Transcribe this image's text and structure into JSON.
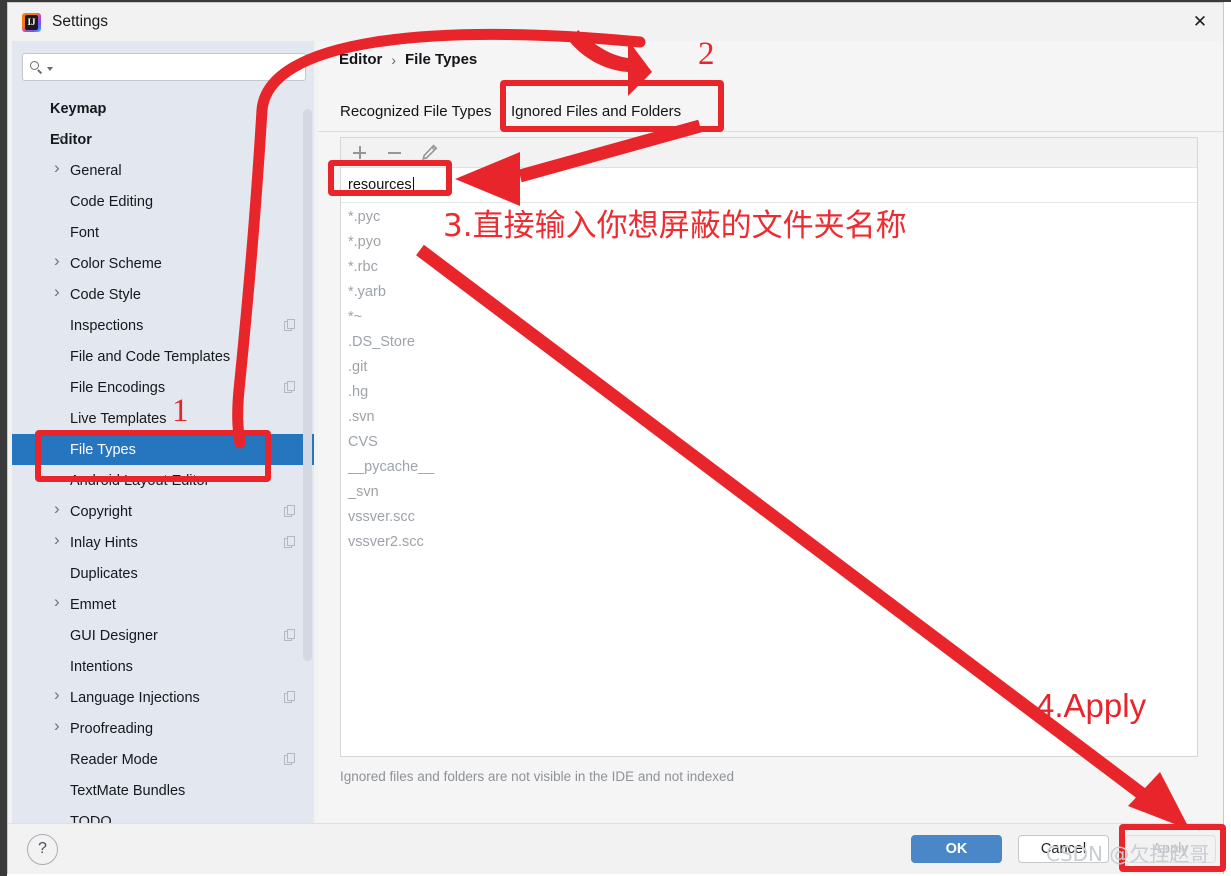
{
  "window": {
    "title": "Settings",
    "app_icon": "intellij-icon",
    "close_icon": "✕"
  },
  "sidebar": {
    "search": {
      "value": "",
      "placeholder": ""
    },
    "items": [
      {
        "label": "Keymap",
        "depth": 0,
        "arrow": "none",
        "badge": false,
        "selected": false
      },
      {
        "label": "Editor",
        "depth": 0,
        "arrow": "down",
        "badge": false,
        "selected": false
      },
      {
        "label": "General",
        "depth": 1,
        "arrow": "right",
        "badge": false,
        "selected": false
      },
      {
        "label": "Code Editing",
        "depth": 1,
        "arrow": "none",
        "badge": false,
        "selected": false
      },
      {
        "label": "Font",
        "depth": 1,
        "arrow": "none",
        "badge": false,
        "selected": false
      },
      {
        "label": "Color Scheme",
        "depth": 1,
        "arrow": "right",
        "badge": false,
        "selected": false
      },
      {
        "label": "Code Style",
        "depth": 1,
        "arrow": "right",
        "badge": false,
        "selected": false
      },
      {
        "label": "Inspections",
        "depth": 1,
        "arrow": "none",
        "badge": true,
        "selected": false
      },
      {
        "label": "File and Code Templates",
        "depth": 1,
        "arrow": "none",
        "badge": false,
        "selected": false
      },
      {
        "label": "File Encodings",
        "depth": 1,
        "arrow": "none",
        "badge": true,
        "selected": false
      },
      {
        "label": "Live Templates",
        "depth": 1,
        "arrow": "none",
        "badge": false,
        "selected": false
      },
      {
        "label": "File Types",
        "depth": 1,
        "arrow": "none",
        "badge": false,
        "selected": true
      },
      {
        "label": "Android Layout Editor",
        "depth": 1,
        "arrow": "none",
        "badge": false,
        "selected": false
      },
      {
        "label": "Copyright",
        "depth": 1,
        "arrow": "right",
        "badge": true,
        "selected": false
      },
      {
        "label": "Inlay Hints",
        "depth": 1,
        "arrow": "right",
        "badge": true,
        "selected": false
      },
      {
        "label": "Duplicates",
        "depth": 1,
        "arrow": "none",
        "badge": false,
        "selected": false
      },
      {
        "label": "Emmet",
        "depth": 1,
        "arrow": "right",
        "badge": false,
        "selected": false
      },
      {
        "label": "GUI Designer",
        "depth": 1,
        "arrow": "none",
        "badge": true,
        "selected": false
      },
      {
        "label": "Intentions",
        "depth": 1,
        "arrow": "none",
        "badge": false,
        "selected": false
      },
      {
        "label": "Language Injections",
        "depth": 1,
        "arrow": "right",
        "badge": true,
        "selected": false
      },
      {
        "label": "Proofreading",
        "depth": 1,
        "arrow": "right",
        "badge": false,
        "selected": false
      },
      {
        "label": "Reader Mode",
        "depth": 1,
        "arrow": "none",
        "badge": true,
        "selected": false
      },
      {
        "label": "TextMate Bundles",
        "depth": 1,
        "arrow": "none",
        "badge": false,
        "selected": false
      },
      {
        "label": "TODO",
        "depth": 1,
        "arrow": "none",
        "badge": false,
        "selected": false
      }
    ]
  },
  "main": {
    "breadcrumb": {
      "parent": "Editor",
      "separator": "›",
      "current": "File Types"
    },
    "tabs": [
      {
        "label": "Recognized File Types",
        "active": false
      },
      {
        "label": "Ignored Files and Folders",
        "active": true
      }
    ],
    "toolbar": {
      "add": "add-icon",
      "remove": "remove-icon",
      "edit": "edit-pencil-icon"
    },
    "edit_field": {
      "value": "resources"
    },
    "ignored_items": [
      "*.pyc",
      "*.pyo",
      "*.rbc",
      "*.yarb",
      "*~",
      ".DS_Store",
      ".git",
      ".hg",
      ".svn",
      "CVS",
      "__pycache__",
      "_svn",
      "vssver.scc",
      "vssver2.scc"
    ],
    "hint": "Ignored files and folders are not visible in the IDE and not indexed"
  },
  "footer": {
    "help": "?",
    "ok": "OK",
    "cancel": "Cancel",
    "apply": "Apply"
  },
  "annotations": {
    "step1": "1",
    "step2": "2",
    "step3": "3.直接输入你想屏蔽的文件夹名称",
    "step4": "4.Apply",
    "color": "#e8252a"
  },
  "watermark": "CSDN @欠捏赵哥"
}
